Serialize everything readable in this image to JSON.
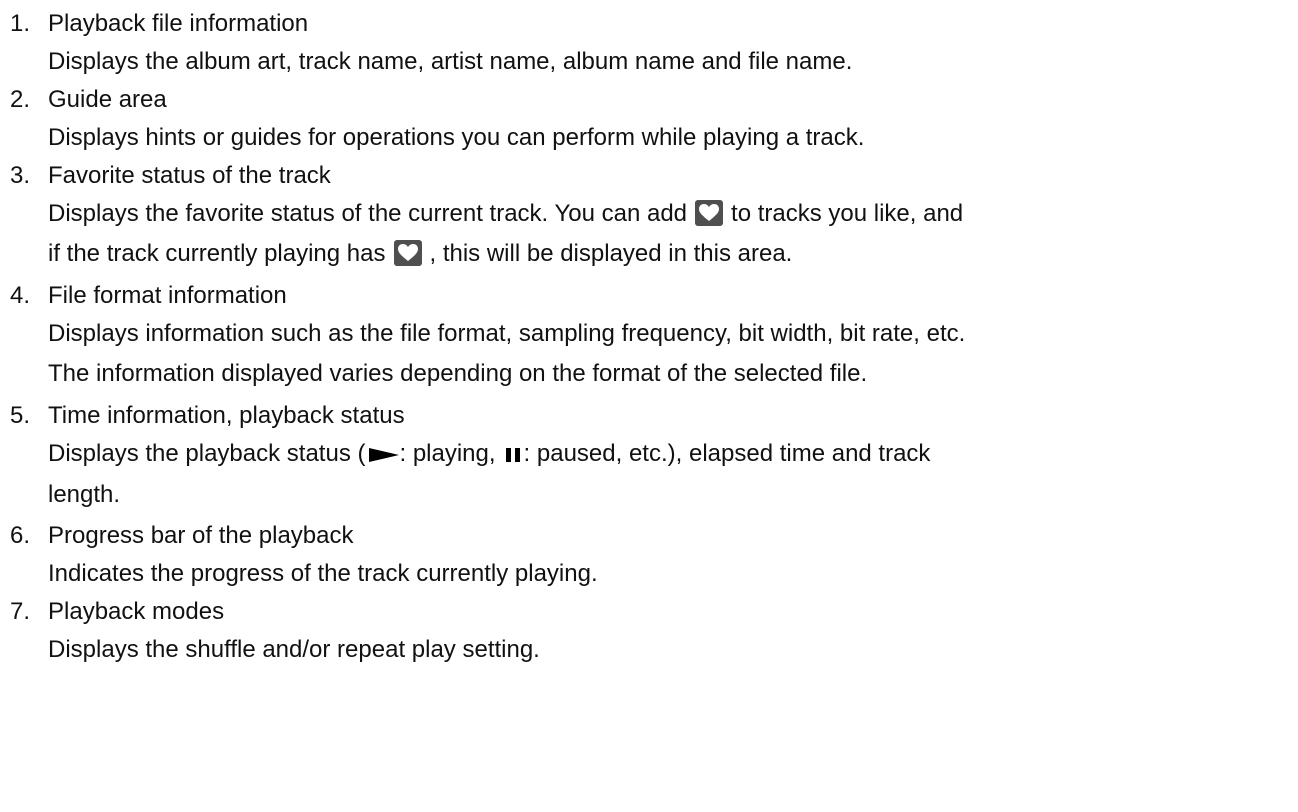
{
  "items": [
    {
      "number": "1.",
      "title": "Playback file information",
      "description": "Displays the album art, track name, artist name, album name and file name."
    },
    {
      "number": "2.",
      "title": "Guide area",
      "description": "Displays hints or guides for operations you can perform while playing a track."
    },
    {
      "number": "3.",
      "title": "Favorite status of the track",
      "description_part1": "Displays the favorite status of the current track. You can add",
      "description_part2": "to tracks you like, and",
      "description_part3": "if the track currently playing has",
      "description_part4": ", this will be displayed in this area.",
      "icon": "heart-icon"
    },
    {
      "number": "4.",
      "title": "File format information",
      "description_line1": "Displays information such as the file format, sampling frequency, bit width, bit rate, etc.",
      "description_line2": "The information displayed varies depending on the format of the selected file."
    },
    {
      "number": "5.",
      "title": "Time information, playback status",
      "description_part1": "Displays the playback status (",
      "description_part2": ": playing,",
      "description_part3": ": paused, etc.), elapsed time and track",
      "description_part4": "length.",
      "icons": [
        "play-icon",
        "pause-icon"
      ]
    },
    {
      "number": "6.",
      "title": "Progress bar of the playback",
      "description": "Indicates the progress of the track currently playing."
    },
    {
      "number": "7.",
      "title": "Playback modes",
      "description": "Displays the shuffle and/or repeat play setting."
    }
  ],
  "colors": {
    "text": "#111111",
    "icon_background": "#4f4f4f",
    "icon_foreground": "#ffffff",
    "glyph": "#000000"
  }
}
